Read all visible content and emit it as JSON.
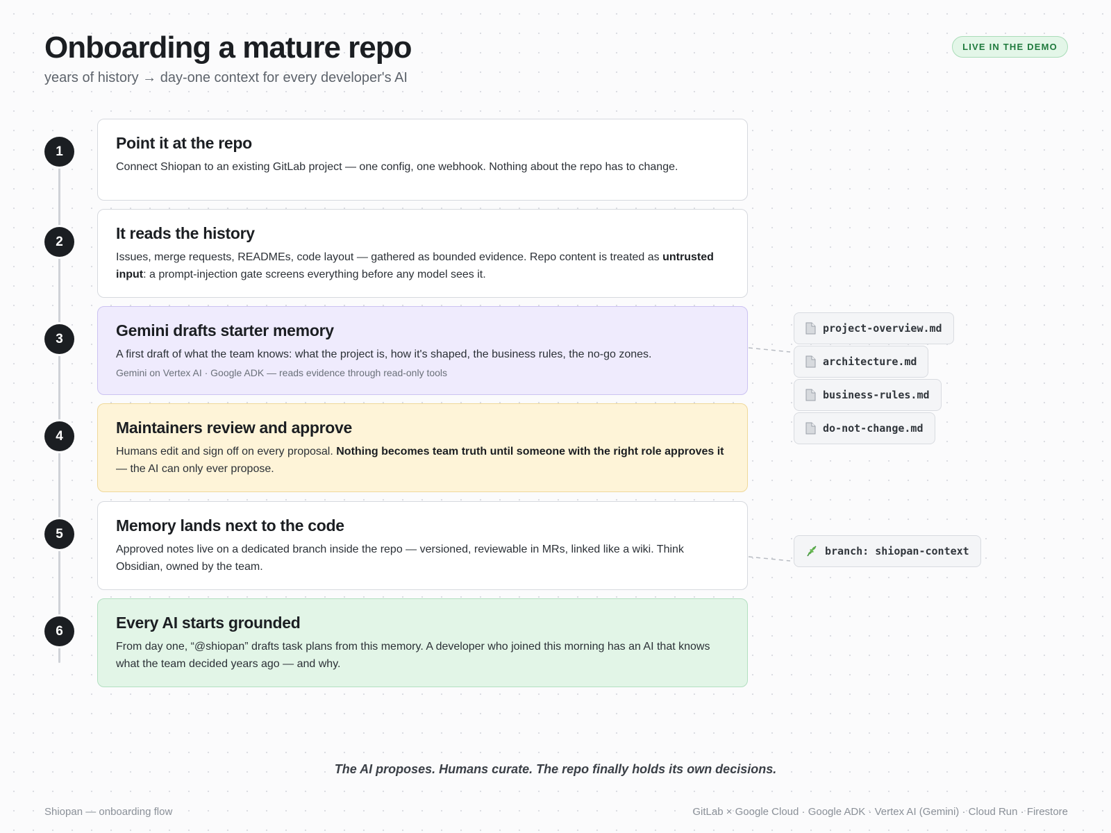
{
  "header": {
    "title": "Onboarding a mature repo",
    "subtitle": "years of history → day-one context for every developer's AI",
    "badge": "LIVE IN THE DEMO"
  },
  "steps": [
    {
      "number": "1",
      "title": "Point it at the repo",
      "body": "Connect Shiopan to an existing GitLab project — one config, one webhook. Nothing about the repo has to change."
    },
    {
      "number": "2",
      "title": "It reads the history",
      "body_lead": "Issues, merge requests, READMEs, code layout — gathered as bounded evidence. Repo content is treated as ",
      "body_strong": "untrusted input",
      "body_tail": ": a prompt-injection gate screens everything before any model sees it."
    },
    {
      "number": "3",
      "title": "Gemini drafts starter memory",
      "body": "A first draft of what the team knows: what the project is, how it's shaped, the business rules, the no-go zones.",
      "note": "Gemini on Vertex AI · Google ADK — reads evidence through read-only tools"
    },
    {
      "number": "4",
      "title": "Maintainers review and approve",
      "body_lead": "Humans edit and sign off on every proposal. ",
      "body_strong": "Nothing becomes team truth until someone with the right role approves it",
      "body_tail": " — the AI can only ever propose."
    },
    {
      "number": "5",
      "title": "Memory lands next to the code",
      "body": "Approved notes live on a dedicated branch inside the repo — versioned, reviewable in MRs, linked like a wiki. Think Obsidian, owned by the team."
    },
    {
      "number": "6",
      "title": "Every AI starts grounded",
      "body": "From day one, “@shiopan” drafts task plans from this memory. A developer who joined this morning has an AI that knows what the team decided years ago — and why."
    }
  ],
  "files": [
    {
      "icon": "file-icon",
      "name": "project-overview.md"
    },
    {
      "icon": "file-icon",
      "name": "architecture.md"
    },
    {
      "icon": "file-icon",
      "name": "business-rules.md"
    },
    {
      "icon": "file-icon",
      "name": "do-not-change.md"
    }
  ],
  "branch": {
    "icon": "herb-icon",
    "label": "branch: shiopan-context"
  },
  "tagline": "The AI proposes. Humans curate. The repo finally holds its own decisions.",
  "footer": {
    "left": "Shiopan — onboarding flow",
    "right": "GitLab × Google Cloud · Google ADK · Vertex AI (Gemini) · Cloud Run · Firestore"
  },
  "colors": {
    "step3": "#efebfd",
    "step4": "#fef4d8",
    "step6": "#e2f5e7",
    "badge": "#1f7a3d"
  }
}
